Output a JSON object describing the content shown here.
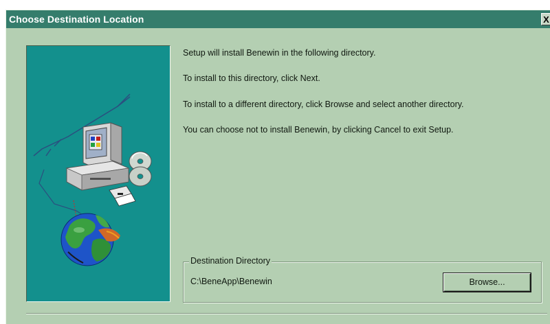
{
  "window": {
    "title": "Choose Destination Location",
    "close_label": "X"
  },
  "content": {
    "lines": [
      "Setup will install Benewin in the following directory.",
      "To install to this directory, click Next.",
      "To install to a different directory, click Browse and select another directory.",
      "You can choose not to install Benewin, by clicking Cancel to exit Setup."
    ]
  },
  "destination": {
    "group_label": "Destination Directory",
    "path": "C:\\BeneApp\\Benewin",
    "browse_label": "Browse..."
  },
  "illustration": {
    "icons": [
      "computer-icon",
      "cd-icon",
      "floppy-disk-icon",
      "globe-icon"
    ]
  },
  "colors": {
    "titlebar": "#357d6c",
    "window_bg": "#b4cfb2",
    "panel_bg": "#13908d"
  }
}
